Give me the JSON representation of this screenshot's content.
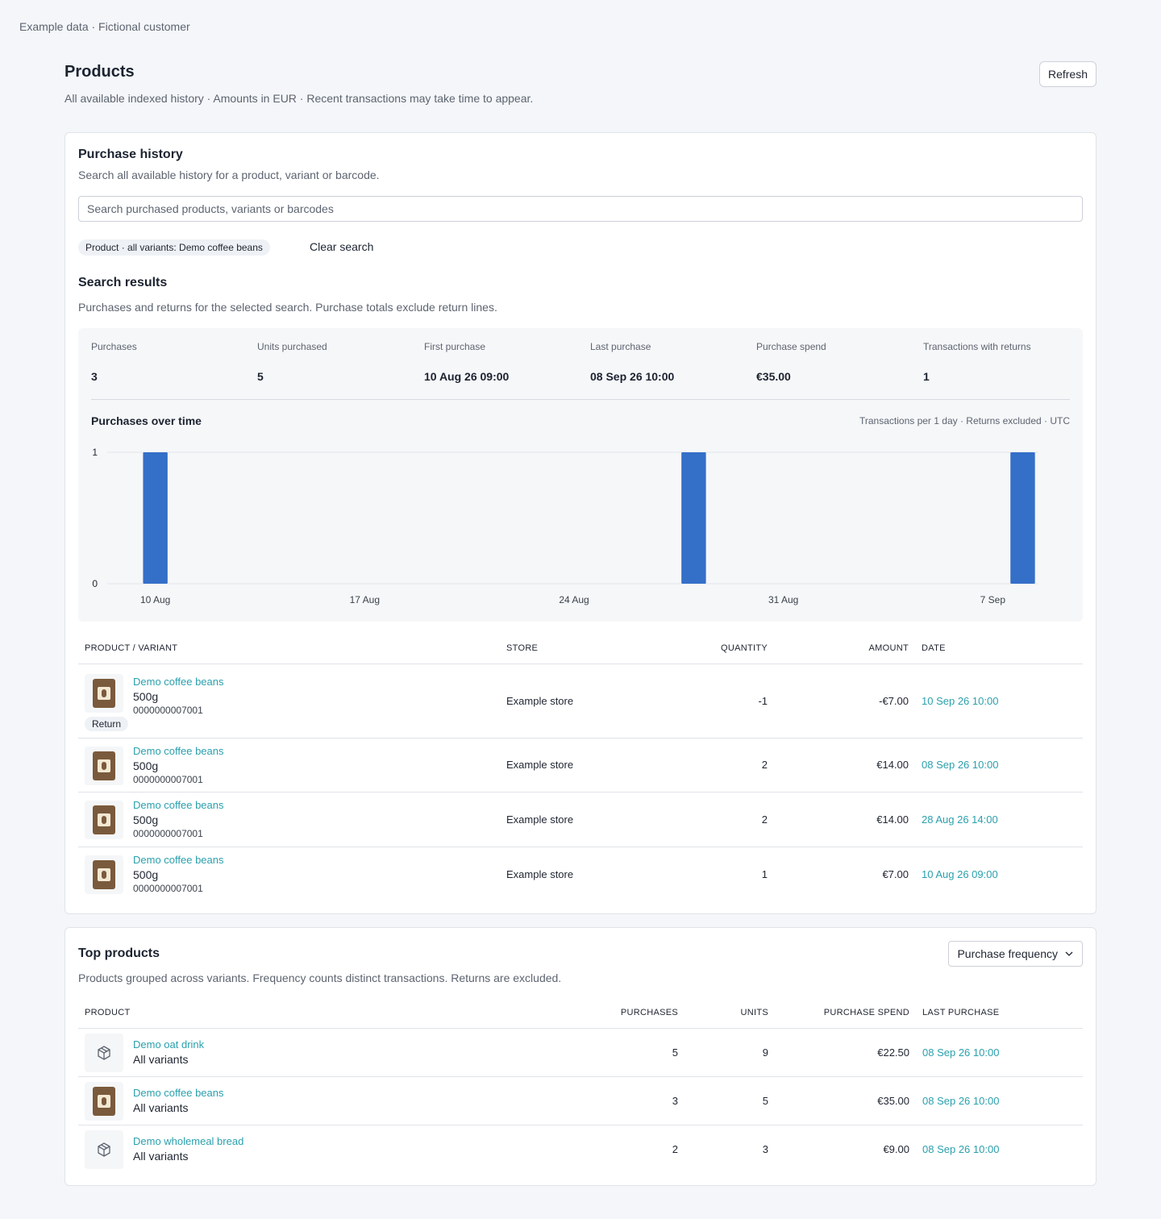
{
  "breadcrumb": "Example data · Fictional customer",
  "header": {
    "title": "Products",
    "subtitle": "All available indexed history · Amounts in EUR · Recent transactions may take time to appear.",
    "refresh_label": "Refresh"
  },
  "history": {
    "title": "Purchase history",
    "description": "Search all available history for a product, variant or barcode.",
    "search_placeholder": "Search purchased products, variants or barcodes",
    "chip": "Product · all variants: Demo coffee beans",
    "clear_label": "Clear search",
    "results_title": "Search results",
    "results_description": "Purchases and returns for the selected search. Purchase totals exclude return lines.",
    "stats": [
      {
        "label": "Purchases",
        "value": "3"
      },
      {
        "label": "Units purchased",
        "value": "5"
      },
      {
        "label": "First purchase",
        "value": "10 Aug 26 09:00"
      },
      {
        "label": "Last purchase",
        "value": "08 Sep 26 10:00"
      },
      {
        "label": "Purchase spend",
        "value": "€35.00"
      },
      {
        "label": "Transactions with returns",
        "value": "1"
      }
    ],
    "chart_title": "Purchases over time",
    "chart_note": "Transactions per 1 day · Returns excluded · UTC",
    "table_headers": {
      "product": "Product / variant",
      "store": "Store",
      "quantity": "Quantity",
      "amount": "Amount",
      "date": "Date"
    },
    "rows": [
      {
        "name": "Demo coffee beans",
        "variant": "500g",
        "barcode": "0000000007001",
        "badge": "Return",
        "store": "Example store",
        "quantity": "-1",
        "amount": "-€7.00",
        "date": "10 Sep 26 10:00"
      },
      {
        "name": "Demo coffee beans",
        "variant": "500g",
        "barcode": "0000000007001",
        "store": "Example store",
        "quantity": "2",
        "amount": "€14.00",
        "date": "08 Sep 26 10:00"
      },
      {
        "name": "Demo coffee beans",
        "variant": "500g",
        "barcode": "0000000007001",
        "store": "Example store",
        "quantity": "2",
        "amount": "€14.00",
        "date": "28 Aug 26 14:00"
      },
      {
        "name": "Demo coffee beans",
        "variant": "500g",
        "barcode": "0000000007001",
        "store": "Example store",
        "quantity": "1",
        "amount": "€7.00",
        "date": "10 Aug 26 09:00"
      }
    ]
  },
  "chart_data": {
    "type": "bar",
    "title": "Purchases over time",
    "bin": "1 day",
    "ylim": [
      0,
      1
    ],
    "y_ticks": [
      "0",
      "1"
    ],
    "x_ticks": [
      {
        "date": "2026-08-10",
        "label": "10 Aug"
      },
      {
        "date": "2026-08-17",
        "label": "17 Aug"
      },
      {
        "date": "2026-08-24",
        "label": "24 Aug"
      },
      {
        "date": "2026-08-31",
        "label": "31 Aug"
      },
      {
        "date": "2026-09-07",
        "label": "7 Sep"
      }
    ],
    "x_range": [
      "2026-08-09",
      "2026-09-09"
    ],
    "bars": [
      {
        "date": "2026-08-10",
        "value": 1
      },
      {
        "date": "2026-08-28",
        "value": 1
      },
      {
        "date": "2026-09-08",
        "value": 1
      }
    ],
    "color": "#346fc8"
  },
  "top": {
    "title": "Top products",
    "description": "Products grouped across variants. Frequency counts distinct transactions. Returns are excluded.",
    "sort_label": "Purchase frequency",
    "table_headers": {
      "product": "Product",
      "purchases": "Purchases",
      "units": "Units",
      "spend": "Purchase spend",
      "last": "Last purchase"
    },
    "rows": [
      {
        "name": "Demo oat drink",
        "variant": "All variants",
        "icon": "box-icon",
        "purchases": "5",
        "units": "9",
        "spend": "€22.50",
        "last": "08 Sep 26 10:00"
      },
      {
        "name": "Demo coffee beans",
        "variant": "All variants",
        "icon": "coffee-bag-icon",
        "purchases": "3",
        "units": "5",
        "spend": "€35.00",
        "last": "08 Sep 26 10:00"
      },
      {
        "name": "Demo wholemeal bread",
        "variant": "All variants",
        "icon": "box-icon",
        "purchases": "2",
        "units": "3",
        "spend": "€9.00",
        "last": "08 Sep 26 10:00"
      }
    ]
  },
  "colors": {
    "accent": "#2aa0ad",
    "bar": "#346fc8"
  }
}
